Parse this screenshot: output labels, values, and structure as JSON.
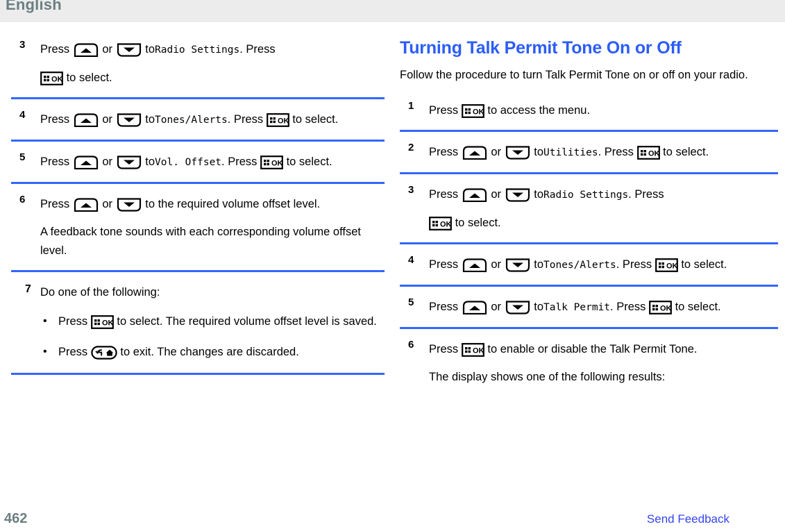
{
  "header": {
    "language": "English"
  },
  "footer": {
    "page_number": "462",
    "feedback_link": "Send Feedback"
  },
  "colors": {
    "accent_blue": "#3366ff",
    "heading_blue": "#2b5df7",
    "link_blue": "#3344ee",
    "header_gray": "#6b7f82",
    "header_band": "#ececec"
  },
  "left_column": {
    "steps": [
      {
        "number": "3",
        "text_1": "Press",
        "or": "or",
        "text_2": "to",
        "menu": "Radio Settings",
        "text_3": ". Press",
        "text_4": "to select."
      },
      {
        "number": "4",
        "text_1": "Press",
        "or": "or",
        "text_2": "to",
        "menu": "Tones/Alerts",
        "text_3": ". Press",
        "text_4": "to select."
      },
      {
        "number": "5",
        "text_1": "Press",
        "or": "or",
        "text_2": "to",
        "menu": "Vol. Offset",
        "text_3": ". Press",
        "text_4": "to select."
      },
      {
        "number": "6",
        "text_1": "Press",
        "or": "or",
        "text_2": "to the required volume offset level.",
        "note": "A feedback tone sounds with each corresponding volume offset level."
      },
      {
        "number": "7",
        "text_1": "Do one of the following:",
        "bullets": [
          {
            "marker": "•",
            "text_1": "Press",
            "text_2": "to select. The required volume offset level is saved."
          },
          {
            "marker": "•",
            "text_1": "Press",
            "text_2": "to exit. The changes are discarded."
          }
        ]
      }
    ]
  },
  "right_column": {
    "title": "Turning Talk Permit Tone On or Off",
    "intro": "Follow the procedure to turn Talk Permit Tone on or off on your radio.",
    "steps": [
      {
        "number": "1",
        "text_1": "Press",
        "text_2": "to access the menu."
      },
      {
        "number": "2",
        "text_1": "Press",
        "or": "or",
        "text_2": "to",
        "menu": "Utilities",
        "text_3": ". Press",
        "text_4": "to select."
      },
      {
        "number": "3",
        "text_1": "Press",
        "or": "or",
        "text_2": "to",
        "menu": "Radio Settings",
        "text_3": ". Press",
        "text_4": "to select."
      },
      {
        "number": "4",
        "text_1": "Press",
        "or": "or",
        "text_2": "to",
        "menu": "Tones/Alerts",
        "text_3": ". Press",
        "text_4": "to select."
      },
      {
        "number": "5",
        "text_1": "Press",
        "or": "or",
        "text_2": "to",
        "menu": "Talk Permit",
        "text_3": ". Press",
        "text_4": "to select."
      },
      {
        "number": "6",
        "text_1": "Press",
        "text_2": "to enable or disable the Talk Permit Tone.",
        "note": "The display shows one of the following results:"
      }
    ]
  },
  "icons": {
    "up": "up-arrow-button-icon",
    "down": "down-arrow-button-icon",
    "ok": "menu-ok-button-icon",
    "back": "back-home-button-icon"
  }
}
